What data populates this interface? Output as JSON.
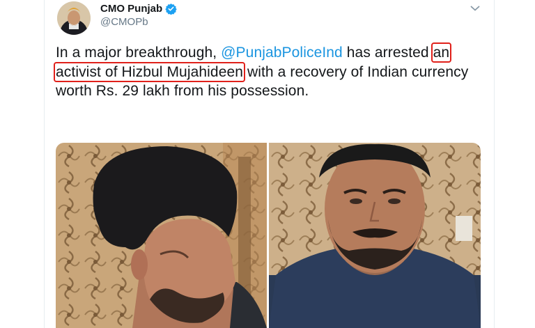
{
  "tweet": {
    "author": {
      "display_name": "CMO Punjab",
      "handle": "@CMOPb",
      "verified": true
    },
    "text": {
      "prefix": "In a major breakthrough, ",
      "mention": "@PunjabPoliceInd",
      "middle": " has arrested ",
      "highlighted": "an activist of Hizbul Mujahideen",
      "suffix": " with a recovery of Indian currency worth Rs. 29 lakh from his possession."
    },
    "media": [
      {
        "name": "left-photo"
      },
      {
        "name": "right-photo"
      }
    ],
    "icons": {
      "verified": "verified-badge-icon",
      "menu": "chevron-down-icon"
    }
  },
  "colors": {
    "mention": "#1b95e0",
    "highlight_box": "#e0201a",
    "verified": "#1da1f2",
    "handle": "#657786"
  }
}
